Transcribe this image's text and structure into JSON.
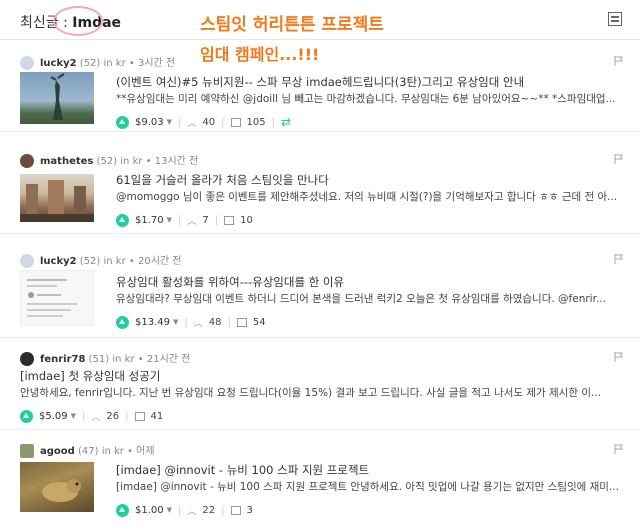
{
  "header": {
    "label": "최신글",
    "separator": " : ",
    "tag": "Imdae"
  },
  "annotation": {
    "line1": "스팀잇 허리튼튼 프로젝트",
    "line2": "임대 캠페인...!!!"
  },
  "colors": {
    "accent": "#1ed0a0",
    "annotation": "#f07a1a",
    "highlight_circle": "#f4a7c4"
  },
  "posts": [
    {
      "author": "lucky2",
      "rep": "(52)",
      "in": "in kr",
      "time": "• 3시간 전",
      "title": "(이벤트 여신)#5 뉴비지원-- 스파 무상 imdae헤드립니다(3탄)그리고 유상임대 안내",
      "body": "**유상임대는 미리 예약하신 @jdoill 님 빼고는 마감하겠습니다. 무상임대는 6분 남아있어요~~** *스파임대업...",
      "payout": "$9.03",
      "votes": "40",
      "comments": "105"
    },
    {
      "author": "mathetes",
      "rep": "(52)",
      "in": "in kr",
      "time": "• 13시간 전",
      "title": "61일을 거슬러 올라가 처음 스팀잇을 만나다",
      "body": "@momoggo 님이 좋은 이벤트를 제안해주셨네요. 저의 뉴비때 시절(?)을 기억해보자고 합니다 ㅎㅎ 근데 전 아...",
      "payout": "$1.70",
      "votes": "7",
      "comments": "10"
    },
    {
      "author": "lucky2",
      "rep": "(52)",
      "in": "in kr",
      "time": "• 20시간 전",
      "title": "유상임대 활성화를 위하여---유상임대를 한 이유",
      "body": "유상임대라? 무상임대 이벤트 하더니 드디어 본색을 드러낸 럭키2 오늘은 첫 유상임대를 하였습니다. @fenrir...",
      "payout": "$13.49",
      "votes": "48",
      "comments": "54"
    },
    {
      "author": "fenrir78",
      "rep": "(51)",
      "in": "in kr",
      "time": "• 21시간 전",
      "title": "[imdae] 첫 유상임대 성공기",
      "body": "안녕하세요, fenrir입니다. 지난 번 유상임대 요청 드립니다(이율 15%) 결과 보고 드립니다. 사실 글을 적고 나서도 제가 제시한 이...",
      "payout": "$5.09",
      "votes": "26",
      "comments": "41"
    },
    {
      "author": "agood",
      "rep": "(47)",
      "in": "in kr",
      "time": "• 어제",
      "title": "[imdae] @innovit - 뉴비 100 스파 지원 프로젝트",
      "body": "[imdae] @innovit - 뉴비 100 스파 지원 프로젝트 안녕하세요. 아직 밋업에 나갈 용기는 없지만 스팀잇에 재미...",
      "payout": "$1.00",
      "votes": "22",
      "comments": "3"
    }
  ]
}
